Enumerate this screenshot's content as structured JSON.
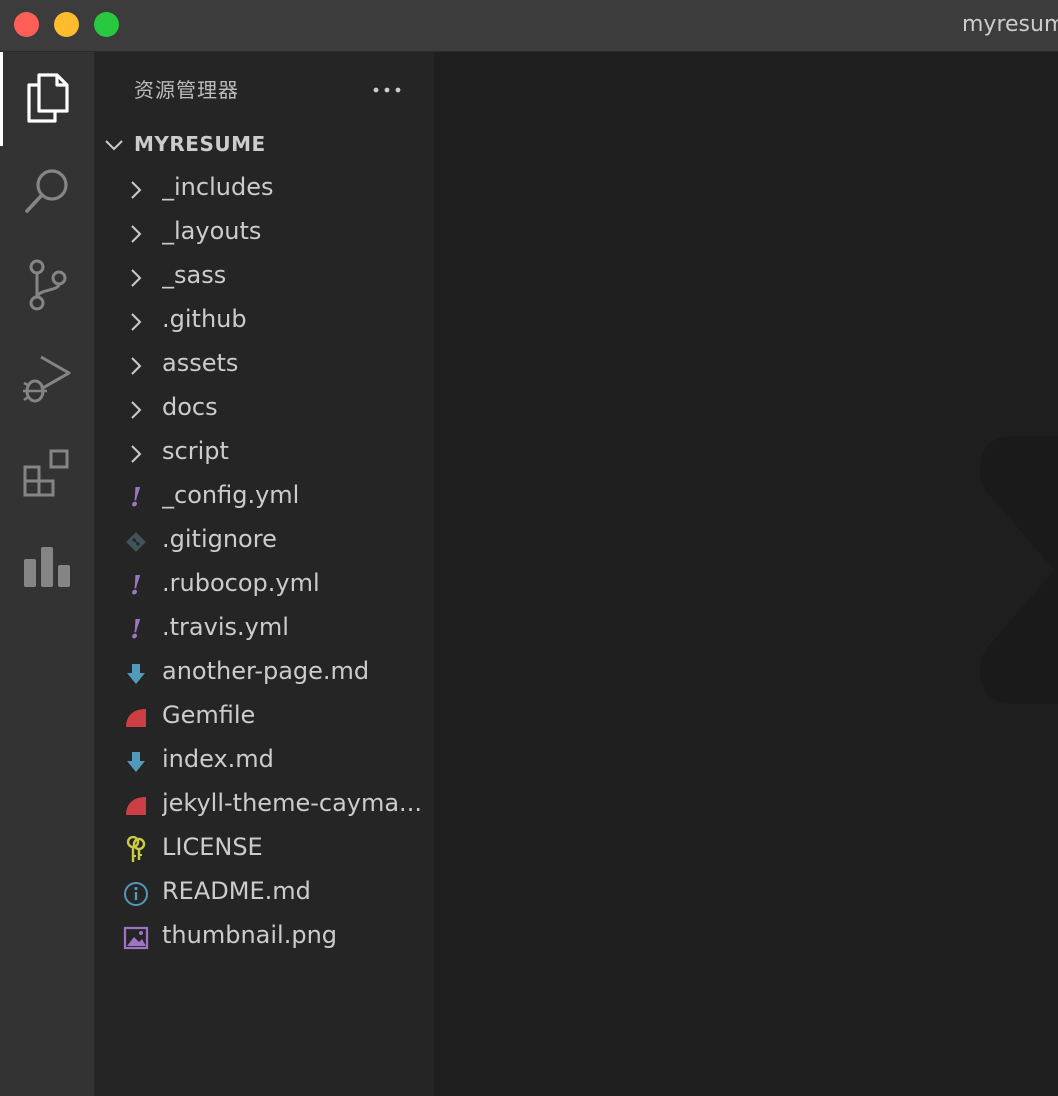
{
  "window": {
    "title": "myresume"
  },
  "colors": {
    "titlebar": "#3c3c3c",
    "activitybar": "#333333",
    "sidebar": "#252526",
    "editor": "#1e1e1e",
    "yaml_icon": "#a074c4",
    "markdown_icon": "#519aba",
    "ruby_icon": "#cc3e44",
    "license_icon": "#cbcb41",
    "image_icon": "#a074c4",
    "info_icon": "#519aba",
    "git_icon": "#41535b"
  },
  "activity_bar": [
    {
      "name": "explorer",
      "icon": "files-icon"
    },
    {
      "name": "search",
      "icon": "search-icon"
    },
    {
      "name": "source-control",
      "icon": "source-control-icon"
    },
    {
      "name": "run-debug",
      "icon": "run-debug-icon"
    },
    {
      "name": "extensions",
      "icon": "extensions-icon"
    },
    {
      "name": "stats",
      "icon": "bar-chart-icon"
    }
  ],
  "sidebar": {
    "title": "资源管理器",
    "more_label": "···",
    "root": {
      "label": "MYRESUME",
      "expanded": true
    },
    "folders": [
      "_includes",
      "_layouts",
      "_sass",
      ".github",
      "assets",
      "docs",
      "script"
    ],
    "files": [
      {
        "label": "_config.yml",
        "icon": "yaml-icon"
      },
      {
        "label": ".gitignore",
        "icon": "git-icon"
      },
      {
        "label": ".rubocop.yml",
        "icon": "yaml-icon"
      },
      {
        "label": ".travis.yml",
        "icon": "yaml-icon"
      },
      {
        "label": "another-page.md",
        "icon": "markdown-icon"
      },
      {
        "label": "Gemfile",
        "icon": "ruby-icon"
      },
      {
        "label": "index.md",
        "icon": "markdown-icon"
      },
      {
        "label": "jekyll-theme-cayma...",
        "icon": "ruby-icon"
      },
      {
        "label": "LICENSE",
        "icon": "license-icon"
      },
      {
        "label": "README.md",
        "icon": "info-icon"
      },
      {
        "label": "thumbnail.png",
        "icon": "image-icon"
      }
    ]
  }
}
